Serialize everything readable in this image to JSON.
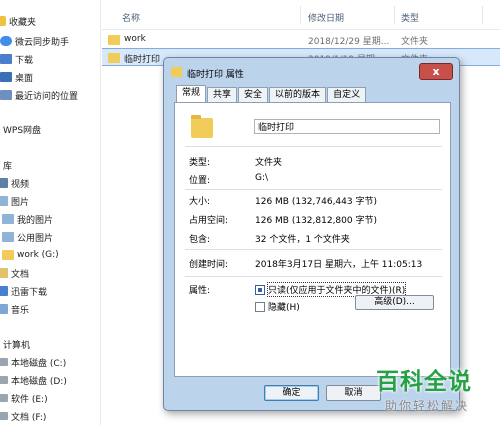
{
  "sidebar": {
    "items": [
      {
        "label": "收藏夹",
        "icon": "star-icon"
      },
      {
        "label": "微云同步助手",
        "icon": "cloud-icon"
      },
      {
        "label": "下载",
        "icon": "download-icon"
      },
      {
        "label": "桌面",
        "icon": "desktop-icon"
      },
      {
        "label": "最近访问的位置",
        "icon": "recent-icon"
      },
      {
        "label": "WPS网盘",
        "icon": "cloud-drive-icon"
      },
      {
        "label": "库",
        "icon": "library-icon"
      },
      {
        "label": "视频",
        "icon": "video-icon"
      },
      {
        "label": "图片",
        "icon": "picture-icon"
      },
      {
        "label": "我的图片",
        "icon": "picture-folder-icon"
      },
      {
        "label": "公用图片",
        "icon": "picture-folder-icon"
      },
      {
        "label": "work (G:)",
        "icon": "folder-icon"
      },
      {
        "label": "文档",
        "icon": "document-icon"
      },
      {
        "label": "迅雷下载",
        "icon": "download-icon"
      },
      {
        "label": "音乐",
        "icon": "music-icon"
      },
      {
        "label": "计算机",
        "icon": "computer-icon"
      },
      {
        "label": "本地磁盘 (C:)",
        "icon": "drive-icon"
      },
      {
        "label": "本地磁盘 (D:)",
        "icon": "drive-icon"
      },
      {
        "label": "软件 (E:)",
        "icon": "drive-icon"
      },
      {
        "label": "文档 (F:)",
        "icon": "drive-icon"
      }
    ]
  },
  "file_list": {
    "columns": {
      "name": "名称",
      "date": "修改日期",
      "type": "类型"
    },
    "rows": [
      {
        "name": "work",
        "date": "2018/12/29 星期...",
        "type": "文件夹"
      },
      {
        "name": "临时打印",
        "date": "2019/1/19 星期...",
        "type": "文件夹"
      }
    ]
  },
  "dialog": {
    "title": "临时打印 属性",
    "close_label": "x",
    "tabs": [
      "常规",
      "共享",
      "安全",
      "以前的版本",
      "自定义"
    ],
    "folder_name": "临时打印",
    "properties": {
      "type_label": "类型:",
      "type_value": "文件夹",
      "location_label": "位置:",
      "location_value": "G:\\",
      "size_label": "大小:",
      "size_value": "126 MB (132,746,443 字节)",
      "disk_size_label": "占用空间:",
      "disk_size_value": "126 MB (132,812,800 字节)",
      "contains_label": "包含:",
      "contains_value": "32 个文件，1 个文件夹",
      "created_label": "创建时间:",
      "created_value": "2018年3月17日 星期六，上午 11:05:13",
      "attributes_label": "属性:"
    },
    "readonly_label": "只读(仅应用于文件夹中的文件)(R)",
    "hidden_label": "隐藏(H)",
    "advanced_label": "高级(D)...",
    "ok_label": "确定",
    "cancel_label": "取消"
  },
  "watermark": {
    "title": "百科全说",
    "subtitle": "助你轻松解决"
  }
}
